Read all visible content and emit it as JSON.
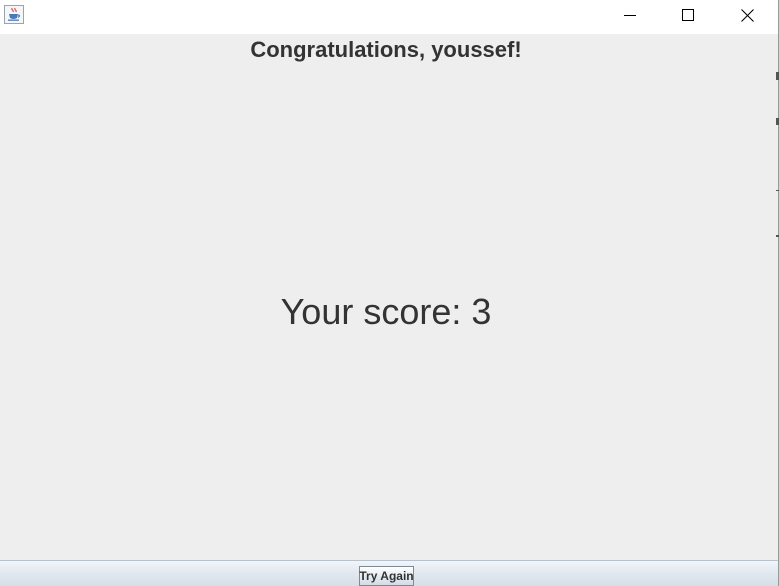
{
  "window": {
    "icon": "java-coffee-cup-icon",
    "controls": {
      "minimize": "minimize-icon",
      "maximize": "maximize-icon",
      "close": "close-icon"
    }
  },
  "main": {
    "greeting": "Congratulations, youssef!",
    "score_text": "Your score: 3"
  },
  "footer": {
    "try_again_label": "Try Again"
  }
}
